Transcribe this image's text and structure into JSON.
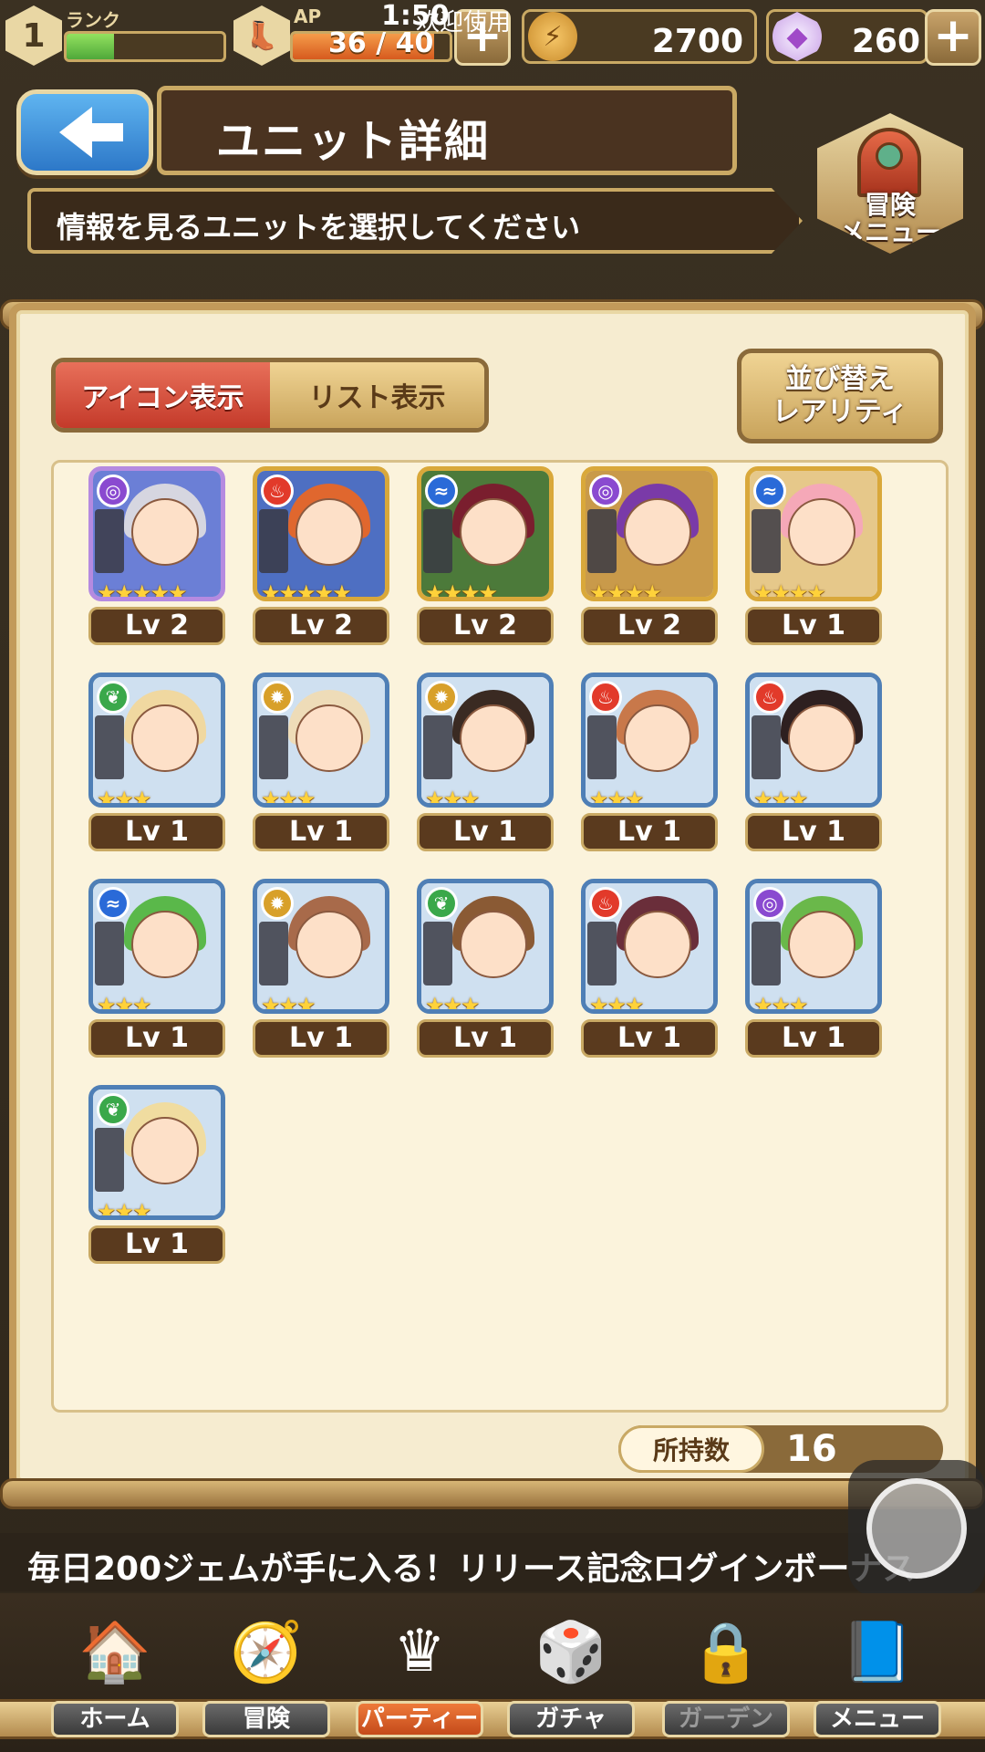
{
  "status": {
    "rank_value": "1",
    "rank_label": "ランク",
    "rank_progress": 0.3,
    "ap_label": "AP",
    "ap_text": "36 / 40",
    "ap_progress": 0.9,
    "clock": "1:50",
    "welcome": "欢迎使用",
    "coins": "2700",
    "gems": "260",
    "plus": "+"
  },
  "header": {
    "title": "ユニット詳細",
    "subtitle": "情報を見るユニットを選択してください",
    "adventure_menu_label": "冒険\nメニュー"
  },
  "panel": {
    "tab_icon_view": "アイコン表示",
    "tab_list_view": "リスト表示",
    "sort_line1": "並び替え",
    "sort_line2": "レアリティ",
    "owned_label": "所持数",
    "owned_value": "16"
  },
  "units": [
    {
      "level": "Lv 2",
      "element": "dark",
      "stars": "★★★★★",
      "rarity": 5,
      "hair": "#d6d6e0",
      "bg": "#6b7fd6"
    },
    {
      "level": "Lv 2",
      "element": "fire",
      "stars": "★★★★★",
      "rarity": 4,
      "hair": "#e0672e",
      "bg": "#4e6fc2"
    },
    {
      "level": "Lv 2",
      "element": "water",
      "stars": "★★★★",
      "rarity": 4,
      "hair": "#7a1e2e",
      "bg": "#4c7a3a"
    },
    {
      "level": "Lv 2",
      "element": "dark",
      "stars": "★★★★",
      "rarity": 4,
      "hair": "#7a3aa8",
      "bg": "#c99a4a"
    },
    {
      "level": "Lv 1",
      "element": "water",
      "stars": "★★★★",
      "rarity": 4,
      "hair": "#f5a8b8",
      "bg": "#e6c88a"
    },
    {
      "level": "Lv 1",
      "element": "wind",
      "stars": "★★★",
      "rarity": 3,
      "hair": "#f0d8a0",
      "bg": "#cfe0f0"
    },
    {
      "level": "Lv 1",
      "element": "light",
      "stars": "★★★",
      "rarity": 3,
      "hair": "#eedcb8",
      "bg": "#cfe0f0"
    },
    {
      "level": "Lv 1",
      "element": "light",
      "stars": "★★★",
      "rarity": 3,
      "hair": "#3a2a22",
      "bg": "#cfe0f0"
    },
    {
      "level": "Lv 1",
      "element": "fire",
      "stars": "★★★",
      "rarity": 3,
      "hair": "#c8784a",
      "bg": "#cfe0f0"
    },
    {
      "level": "Lv 1",
      "element": "fire",
      "stars": "★★★",
      "rarity": 3,
      "hair": "#2e2020",
      "bg": "#cfe0f0"
    },
    {
      "level": "Lv 1",
      "element": "water",
      "stars": "★★★",
      "rarity": 3,
      "hair": "#5ab84a",
      "bg": "#cfe0f0"
    },
    {
      "level": "Lv 1",
      "element": "light",
      "stars": "★★★",
      "rarity": 3,
      "hair": "#a86a4a",
      "bg": "#cfe0f0"
    },
    {
      "level": "Lv 1",
      "element": "wind",
      "stars": "★★★",
      "rarity": 3,
      "hair": "#8a5a34",
      "bg": "#cfe0f0"
    },
    {
      "level": "Lv 1",
      "element": "fire",
      "stars": "★★★",
      "rarity": 3,
      "hair": "#6a2e3a",
      "bg": "#cfe0f0"
    },
    {
      "level": "Lv 1",
      "element": "dark",
      "stars": "★★★",
      "rarity": 3,
      "hair": "#6ab84a",
      "bg": "#cfe0f0"
    },
    {
      "level": "Lv 1",
      "element": "wind",
      "stars": "★★★",
      "rarity": 3,
      "hair": "#f0dca0",
      "bg": "#cfe0f0"
    }
  ],
  "element_colors": {
    "dark": "#8a4ad0",
    "fire": "#e23a2a",
    "water": "#2a6ad8",
    "wind": "#3aa84a",
    "light": "#d8a02a"
  },
  "element_glyphs": {
    "dark": "◎",
    "fire": "♨",
    "water": "≈",
    "wind": "❦",
    "light": "✹"
  },
  "ticker": "毎日200ジェムが手に入る！リリース記念ログインボーナス",
  "nav": [
    {
      "label": "ホーム",
      "icon": "home-icon",
      "glyph": "🏠",
      "state": "normal"
    },
    {
      "label": "冒険",
      "icon": "adventure-icon",
      "glyph": "🧭",
      "state": "normal"
    },
    {
      "label": "パーティー",
      "icon": "party-icon",
      "glyph": "♛",
      "state": "active"
    },
    {
      "label": "ガチャ",
      "icon": "gacha-icon",
      "glyph": "🎲",
      "state": "normal"
    },
    {
      "label": "ガーデン",
      "icon": "garden-lock-icon",
      "glyph": "🔒",
      "state": "disabled"
    },
    {
      "label": "メニュー",
      "icon": "menu-book-icon",
      "glyph": "📘",
      "state": "normal"
    }
  ]
}
